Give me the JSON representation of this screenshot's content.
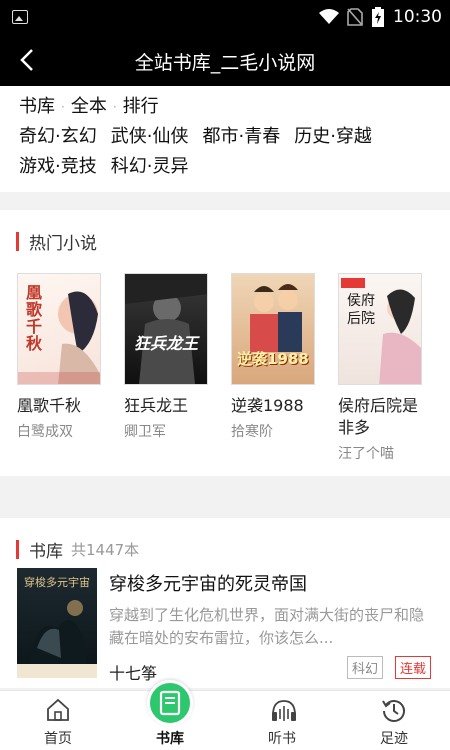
{
  "status_bar": {
    "time": "10:30",
    "icons": [
      "image-icon",
      "wifi-icon",
      "no-sim-icon",
      "battery-charging-icon"
    ]
  },
  "header": {
    "title": "全站书库_二毛小说网"
  },
  "nav_links": [
    "书库",
    "全本",
    "排行"
  ],
  "categories": [
    [
      "奇幻·玄幻",
      "武侠·仙侠",
      "都市·青春",
      "历史·穿越"
    ],
    [
      "游戏·竞技",
      "科幻·灵异"
    ]
  ],
  "hot": {
    "title": "热门小说",
    "books": [
      {
        "name": "凰歌千秋",
        "author": "白鹭成双",
        "cover_text": "凰歌千秋"
      },
      {
        "name": "狂兵龙王",
        "author": "卿卫军",
        "cover_text": "狂兵龙王"
      },
      {
        "name": "逆袭1988",
        "author": "拾寒阶",
        "cover_text": "逆袭1988"
      },
      {
        "name": "侯府后院是非多",
        "author": "汪了个喵",
        "cover_text": "侯府后院"
      }
    ]
  },
  "library": {
    "title": "书库",
    "count": "共1447本",
    "books": [
      {
        "title": "穿梭多元宇宙的死灵帝国",
        "desc": "穿越到了生化危机世界，面对满大街的丧尸和隐藏在暗处的安布雷拉，你该怎么...",
        "author": "十七筝",
        "genre": "科幻",
        "status": "连载"
      }
    ]
  },
  "tabs": [
    {
      "label": "首页",
      "icon": "home-icon"
    },
    {
      "label": "书库",
      "icon": "book-icon",
      "active": true
    },
    {
      "label": "听书",
      "icon": "headphones-icon"
    },
    {
      "label": "足迹",
      "icon": "history-icon"
    }
  ],
  "colors": {
    "accent": "#e53935",
    "tab_active": "#2dc76d",
    "header_bg": "#000000"
  }
}
